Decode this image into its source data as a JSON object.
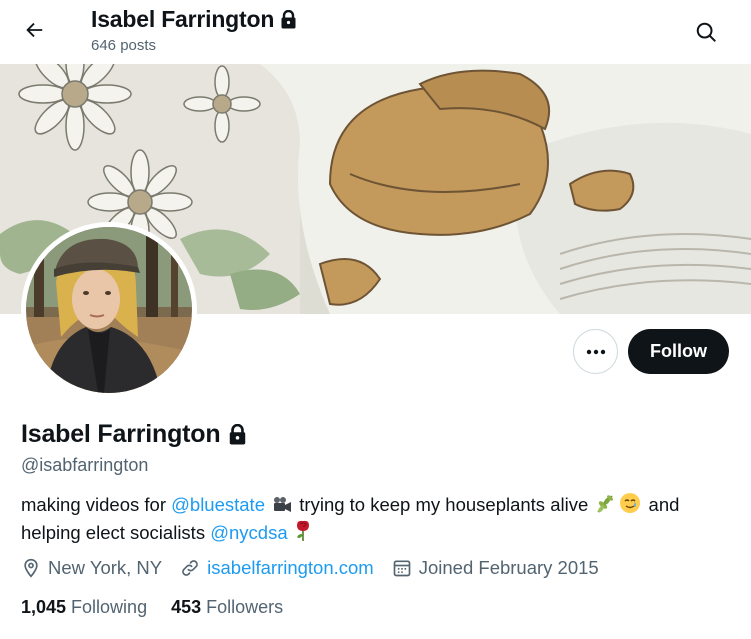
{
  "header": {
    "name": "Isabel Farrington",
    "post_count": "646 posts",
    "back_icon": "arrow-left-icon",
    "search_icon": "search-icon"
  },
  "profile": {
    "name": "Isabel Farrington",
    "handle": "@isabfarrington",
    "protected_icon": "lock-icon",
    "bio": {
      "text_1": "making videos for ",
      "mention_1": "@bluestate",
      "emoji_1": "movie-camera-emoji",
      "text_2": " trying to keep my houseplants alive ",
      "emoji_2": "herb-emoji",
      "emoji_3": "smiling-face-with-tear-emoji",
      "text_3": " and helping elect socialists ",
      "mention_2": "@nycdsa",
      "emoji_4": "rose-emoji"
    },
    "location": "New York, NY",
    "website": "isabelfarrington.com",
    "joined": "Joined February 2015",
    "following_count": "1,045",
    "following_label": "Following",
    "followers_count": "453",
    "followers_label": "Followers"
  },
  "actions": {
    "more_icon": "more-horizontal-icon",
    "follow_label": "Follow"
  },
  "colors": {
    "accent": "#1d9bf0",
    "text_primary": "#0f1419",
    "text_secondary": "#536471",
    "follow_bg": "#0f1419",
    "border": "#cfd9de"
  }
}
